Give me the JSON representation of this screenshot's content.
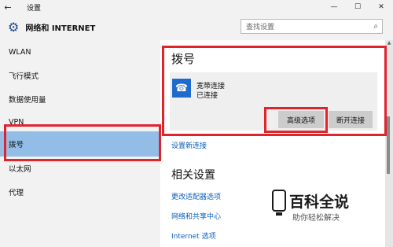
{
  "titlebar": {
    "back_icon": "back-arrow-icon",
    "title": "设置",
    "controls": [
      "—",
      "☐",
      "✕"
    ]
  },
  "header": {
    "icon": "gear-icon",
    "title": "网络和 INTERNET",
    "search_placeholder": "查找设置"
  },
  "sidebar": {
    "items": [
      {
        "label": "WLAN",
        "selected": false
      },
      {
        "label": "飞行模式",
        "selected": false
      },
      {
        "label": "数据使用量",
        "selected": false
      },
      {
        "label": "VPN",
        "selected": false
      },
      {
        "label": "拨号",
        "selected": true
      },
      {
        "label": "以太网",
        "selected": false
      },
      {
        "label": "代理",
        "selected": false
      }
    ]
  },
  "main": {
    "section_title": "拨号",
    "connection": {
      "icon": "phone-icon",
      "name": "宽带连接",
      "status": "已连接",
      "advanced_label": "高级选项",
      "disconnect_label": "断开连接"
    },
    "new_connection_link": "设置新连接",
    "related_title": "相关设置",
    "related_links": [
      "更改适配器选项",
      "网络和共享中心",
      "Internet 选项"
    ]
  },
  "watermark": {
    "title": "百科全说",
    "subtitle": "助你轻松解决"
  },
  "colors": {
    "selected": "#91bde7",
    "annotation": "#e1232c",
    "link": "#0b5fbd",
    "connection_icon": "#1f6bcd"
  }
}
